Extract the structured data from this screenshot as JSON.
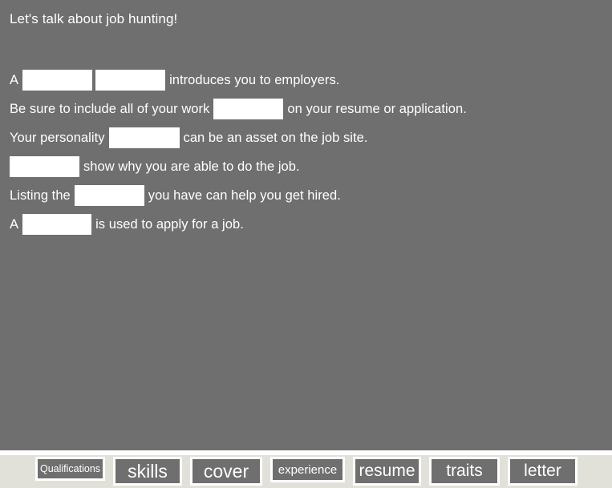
{
  "panel": {
    "title": "Let's talk about job hunting!",
    "background_color": "#706f6f",
    "text_color": "#ffffff",
    "sentences": [
      {
        "id": "sentence-1",
        "parts": [
          {
            "type": "text",
            "value": "A"
          },
          {
            "type": "blank",
            "value": ""
          },
          {
            "type": "blank",
            "value": ""
          },
          {
            "type": "text",
            "value": "introduces you to employers."
          }
        ]
      },
      {
        "id": "sentence-2",
        "parts": [
          {
            "type": "text",
            "value": "Be sure to include all of your work"
          },
          {
            "type": "blank",
            "value": ""
          },
          {
            "type": "text",
            "value": "on your resume or application."
          }
        ]
      },
      {
        "id": "sentence-3",
        "parts": [
          {
            "type": "text",
            "value": "Your personality"
          },
          {
            "type": "blank",
            "value": ""
          },
          {
            "type": "text",
            "value": "can be an asset on the job site."
          }
        ]
      },
      {
        "id": "sentence-4",
        "parts": [
          {
            "type": "blank",
            "value": ""
          },
          {
            "type": "text",
            "value": "show why you are able to do the job."
          }
        ]
      },
      {
        "id": "sentence-5",
        "parts": [
          {
            "type": "text",
            "value": "Listing the"
          },
          {
            "type": "blank",
            "value": ""
          },
          {
            "type": "text",
            "value": "you have can help you get hired."
          }
        ]
      },
      {
        "id": "sentence-6",
        "parts": [
          {
            "type": "text",
            "value": "A"
          },
          {
            "type": "blank",
            "value": ""
          },
          {
            "type": "text",
            "value": "is used to apply for a job."
          }
        ]
      }
    ]
  },
  "word_bank": {
    "background_color": "#e1e1d9",
    "tile_fill_color": "#706f6f",
    "tile_border_color": "#ffffff",
    "tiles": [
      {
        "label": "Qualifications",
        "size": "xs",
        "width": 87
      },
      {
        "label": "skills",
        "size": "xl",
        "width": 86
      },
      {
        "label": "cover",
        "size": "xl",
        "width": 90
      },
      {
        "label": "experience",
        "size": "sm",
        "width": 93
      },
      {
        "label": "resume",
        "size": "lg",
        "width": 85
      },
      {
        "label": "traits",
        "size": "lg",
        "width": 88
      },
      {
        "label": "letter",
        "size": "lg",
        "width": 87
      }
    ]
  },
  "sentence_text": {
    "s1_a": "A",
    "s1_tail": "introduces you to employers.",
    "s2_head": "Be sure to include all of your work",
    "s2_tail": "on your resume or application.",
    "s3_head": "Your personality",
    "s3_tail": "can be an asset on the job site.",
    "s4_tail": "show why you are able to do the job.",
    "s5_head": "Listing the",
    "s5_tail": "you have can help you get hired.",
    "s6_a": "A",
    "s6_tail": "is used to apply for a job."
  }
}
